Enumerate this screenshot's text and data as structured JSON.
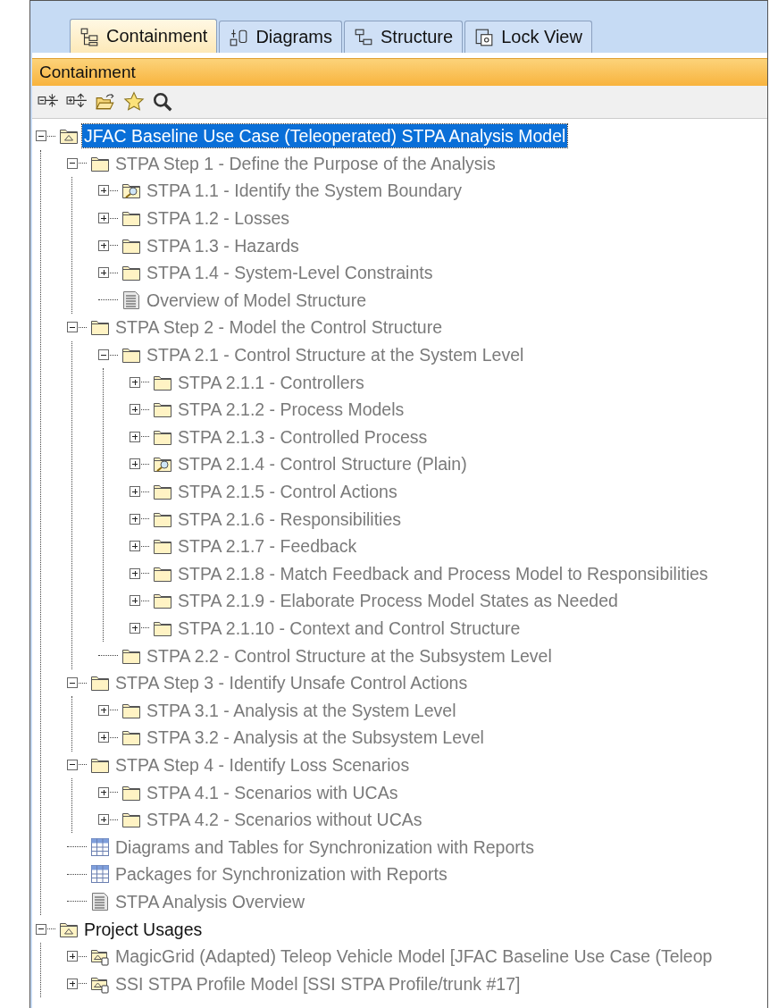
{
  "tabs": [
    {
      "label": "Containment",
      "selected": true
    },
    {
      "label": "Diagrams",
      "selected": false
    },
    {
      "label": "Structure",
      "selected": false
    },
    {
      "label": "Lock View",
      "selected": false
    }
  ],
  "panel": {
    "title": "Containment"
  },
  "tree": [
    {
      "label": "JFAC Baseline Use Case (Teleoperated) STPA Analysis Model",
      "kind": "model",
      "expanded": true,
      "selected": true,
      "children": [
        {
          "label": "STPA Step 1 - Define the Purpose of the Analysis",
          "kind": "folder",
          "expanded": true,
          "greyed": true,
          "selected": false,
          "children": [
            {
              "label": "STPA 1.1 - Identify the System Boundary",
              "kind": "folder-search",
              "expanded": false,
              "greyed": true,
              "selected": false
            },
            {
              "label": "STPA 1.2 - Losses",
              "kind": "folder",
              "expanded": false,
              "greyed": true,
              "selected": false
            },
            {
              "label": "STPA 1.3 - Hazards",
              "kind": "folder",
              "expanded": false,
              "greyed": true,
              "selected": false
            },
            {
              "label": "STPA 1.4 - System-Level Constraints",
              "kind": "folder",
              "expanded": false,
              "greyed": true,
              "selected": false
            },
            {
              "label": "Overview of Model Structure",
              "kind": "document",
              "greyed": true,
              "selected": false
            }
          ]
        },
        {
          "label": "STPA Step 2 - Model the Control Structure",
          "kind": "folder",
          "expanded": true,
          "greyed": true,
          "selected": false,
          "children": [
            {
              "label": "STPA 2.1 - Control Structure at the System Level",
              "kind": "folder",
              "expanded": true,
              "greyed": true,
              "selected": false,
              "children": [
                {
                  "label": "STPA 2.1.1 - Controllers",
                  "kind": "folder",
                  "expanded": false,
                  "greyed": true,
                  "selected": false
                },
                {
                  "label": "STPA 2.1.2 - Process Models",
                  "kind": "folder",
                  "expanded": false,
                  "greyed": true,
                  "selected": false
                },
                {
                  "label": "STPA 2.1.3 - Controlled Process",
                  "kind": "folder",
                  "expanded": false,
                  "greyed": true,
                  "selected": false
                },
                {
                  "label": "STPA 2.1.4 - Control Structure (Plain)",
                  "kind": "folder-search",
                  "expanded": false,
                  "greyed": true,
                  "selected": false
                },
                {
                  "label": "STPA 2.1.5 - Control Actions",
                  "kind": "folder",
                  "expanded": false,
                  "greyed": true,
                  "selected": false
                },
                {
                  "label": "STPA 2.1.6 - Responsibilities",
                  "kind": "folder",
                  "expanded": false,
                  "greyed": true,
                  "selected": false
                },
                {
                  "label": "STPA 2.1.7 - Feedback",
                  "kind": "folder",
                  "expanded": false,
                  "greyed": true,
                  "selected": false
                },
                {
                  "label": "STPA 2.1.8 - Match Feedback and Process Model to Responsibilities",
                  "kind": "folder",
                  "expanded": false,
                  "greyed": true,
                  "selected": false
                },
                {
                  "label": "STPA 2.1.9 - Elaborate Process Model States as Needed",
                  "kind": "folder",
                  "expanded": false,
                  "greyed": true,
                  "selected": false
                },
                {
                  "label": "STPA 2.1.10 - Context and Control Structure",
                  "kind": "folder",
                  "expanded": false,
                  "greyed": true,
                  "selected": false
                }
              ]
            },
            {
              "label": "STPA 2.2 - Control Structure at the Subsystem Level",
              "kind": "folder",
              "greyed": true,
              "selected": false
            }
          ]
        },
        {
          "label": "STPA Step 3 - Identify Unsafe Control Actions",
          "kind": "folder",
          "expanded": true,
          "greyed": true,
          "selected": false,
          "children": [
            {
              "label": "STPA 3.1 - Analysis at the System Level",
              "kind": "folder",
              "expanded": false,
              "greyed": true,
              "selected": false
            },
            {
              "label": "STPA 3.2 - Analysis at the Subsystem Level",
              "kind": "folder",
              "expanded": false,
              "greyed": true,
              "selected": false
            }
          ]
        },
        {
          "label": "STPA Step 4 - Identify Loss Scenarios",
          "kind": "folder",
          "expanded": true,
          "greyed": true,
          "selected": false,
          "children": [
            {
              "label": "STPA 4.1 - Scenarios with UCAs",
              "kind": "folder",
              "expanded": false,
              "greyed": true,
              "selected": false
            },
            {
              "label": "STPA 4.2 - Scenarios without UCAs",
              "kind": "folder",
              "expanded": false,
              "greyed": true,
              "selected": false
            }
          ]
        },
        {
          "label": "Diagrams and Tables for Synchronization with Reports",
          "kind": "table",
          "greyed": true,
          "selected": false
        },
        {
          "label": "Packages for Synchronization with Reports",
          "kind": "table",
          "greyed": true,
          "selected": false
        },
        {
          "label": "STPA Analysis Overview",
          "kind": "document",
          "greyed": true,
          "selected": false
        }
      ]
    },
    {
      "label": "Project Usages",
      "kind": "model",
      "expanded": true,
      "greyed": false,
      "selected": false,
      "children": [
        {
          "label": "MagicGrid (Adapted) Teleop Vehicle Model [JFAC Baseline Use Case (Teleop",
          "kind": "usage",
          "expanded": false,
          "greyed": true,
          "selected": false
        },
        {
          "label": "SSI STPA Profile Model [SSI STPA Profile/trunk #17]",
          "kind": "usage",
          "expanded": false,
          "greyed": true,
          "selected": false
        }
      ]
    }
  ]
}
